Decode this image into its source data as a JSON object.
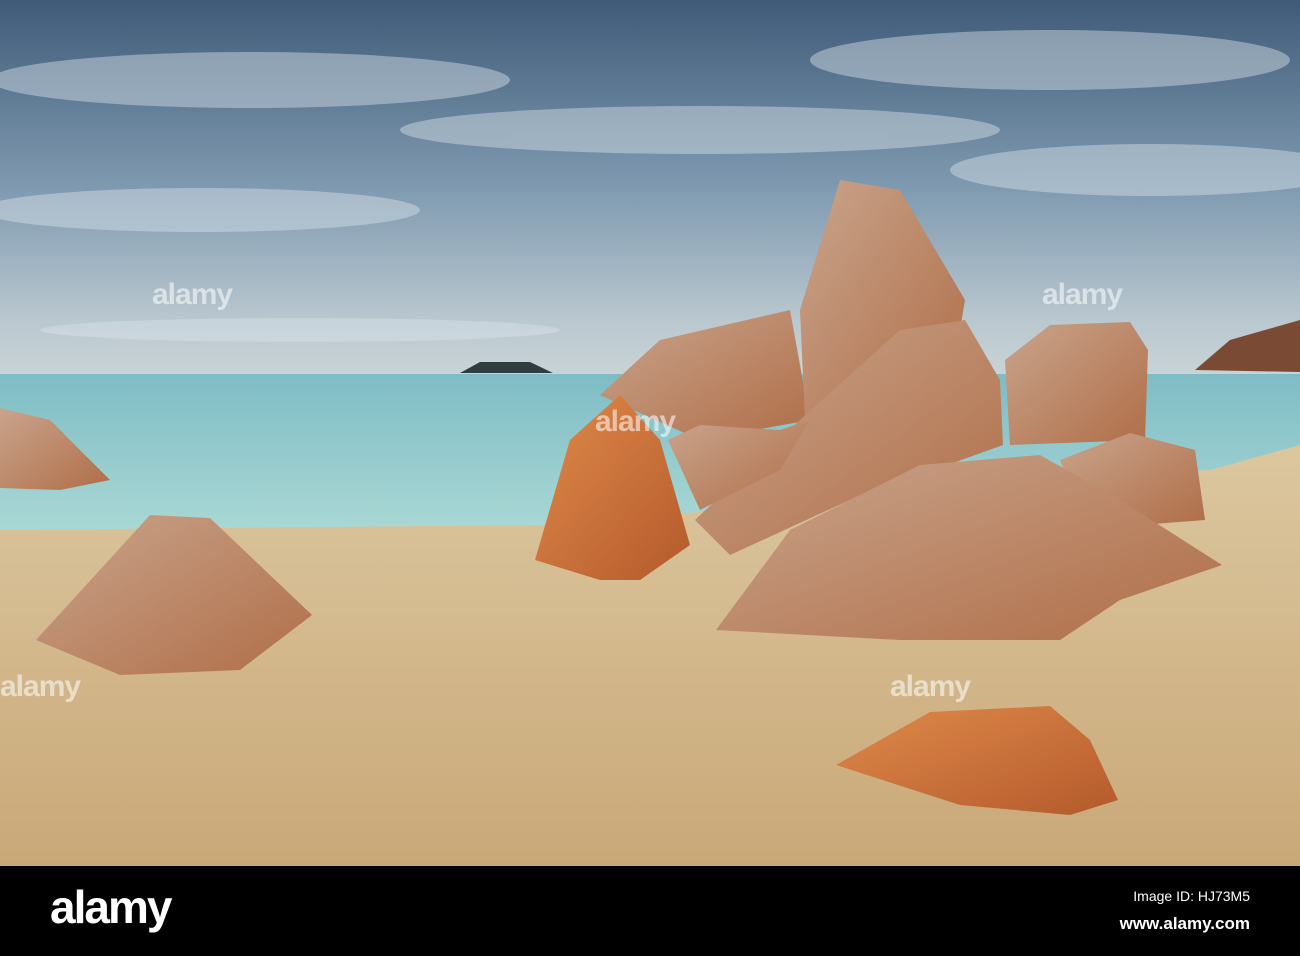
{
  "photo": {
    "subject": "Rocky sandy beach under cloudy sky"
  },
  "watermark": {
    "text": "alamy"
  },
  "footer": {
    "logo": "alamy",
    "image_id": "Image ID: HJ73M5",
    "website": "www.alamy.com"
  },
  "colors": {
    "sky": "#5f7f9c",
    "sea": "#8fcfd0",
    "sand": "#d6b988",
    "rock": "#c98a62"
  }
}
